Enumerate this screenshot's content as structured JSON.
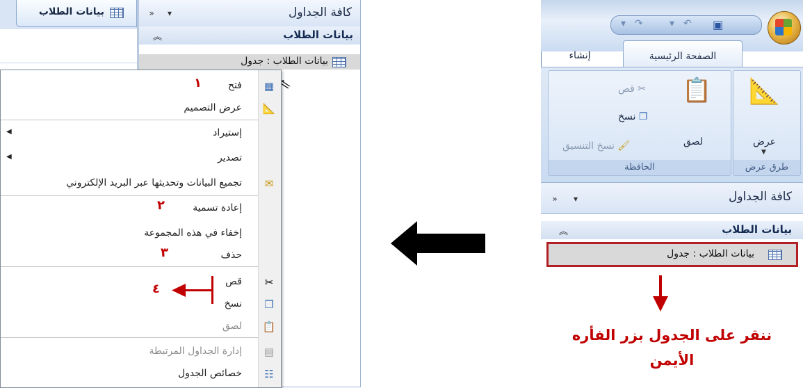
{
  "left_panel": {
    "doc_tab": "بيانات الطلاب",
    "nav_title": "كافة الجداول",
    "group_title": "بيانات الطلاب",
    "group_collapse": "≈",
    "nav_item": "بيانات الطلاب : جدول",
    "menu": {
      "items": [
        {
          "label": "فتح",
          "icon": "open-table-icon",
          "disabled": false,
          "submenu": false
        },
        {
          "label": "عرض التصميم",
          "icon": "design-view-icon",
          "disabled": false,
          "submenu": false
        },
        {
          "label": "إستيراد",
          "icon": "",
          "disabled": false,
          "submenu": true
        },
        {
          "label": "تصدير",
          "icon": "",
          "disabled": false,
          "submenu": true
        },
        {
          "label": "تجميع البيانات وتحديثها عبر البريد الإلكتروني",
          "icon": "collect-data-icon",
          "disabled": false,
          "submenu": false
        },
        {
          "label": "إعادة تسمية",
          "icon": "",
          "disabled": false,
          "submenu": false
        },
        {
          "label": "إخفاء في هذه المجموعة",
          "icon": "",
          "disabled": false,
          "submenu": false
        },
        {
          "label": "حذف",
          "icon": "",
          "disabled": false,
          "submenu": false
        },
        {
          "label": "قص",
          "icon": "scissors-icon",
          "disabled": false,
          "submenu": false
        },
        {
          "label": "نسخ",
          "icon": "copy-icon",
          "disabled": false,
          "submenu": false
        },
        {
          "label": "لصق",
          "icon": "paste-icon",
          "disabled": true,
          "submenu": false
        },
        {
          "label": "إدارة الجداول المرتبطة",
          "icon": "linked-table-manager-icon",
          "disabled": true,
          "submenu": false
        },
        {
          "label": "خصائص الجدول",
          "icon": "table-properties-icon",
          "disabled": false,
          "submenu": false
        }
      ]
    },
    "annotations": {
      "n1": "١",
      "n2": "٢",
      "n3": "٣",
      "n4": "٤"
    }
  },
  "right_panel": {
    "tabs": {
      "home": "الصفحة الرئيسية",
      "create": "إنشاء"
    },
    "ribbon": {
      "view_btn": "عرض",
      "view_group": "طرق عرض",
      "paste_btn": "لصق",
      "cut_btn": "قص",
      "copy_btn": "نسخ",
      "format_painter_btn": "نسخ التنسيق",
      "clipboard_group": "الحافظة"
    },
    "nav_title": "كافة الجداول",
    "group_title": "بيانات الطلاب",
    "group_collapse": "≈",
    "nav_item": "بيانات الطلاب : جدول",
    "instruction_line1": "ننقر على الجدول بزر الفأره",
    "instruction_line2": "الأيمن"
  },
  "colors": {
    "annotation_red": "#c00000",
    "arrow_black": "#000000",
    "highlight_border": "#b21f24"
  }
}
